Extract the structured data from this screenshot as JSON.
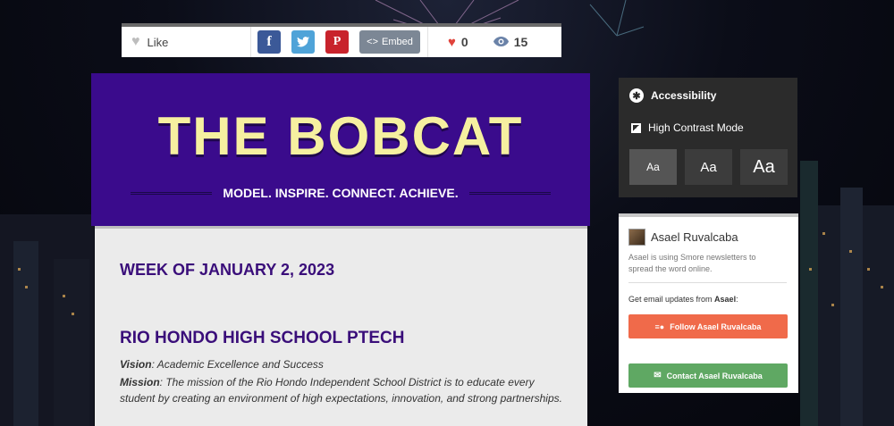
{
  "share_bar": {
    "like_label": "Like",
    "embed_label": "Embed",
    "likes_count": "0",
    "views_count": "15"
  },
  "header": {
    "title": "THE BOBCAT",
    "tagline": "MODEL. INSPIRE. CONNECT. ACHIEVE."
  },
  "content": {
    "week_heading": "WEEK OF JANUARY 2, 2023",
    "school_heading": "RIO HONDO HIGH SCHOOL PTECH",
    "vision_label": "Vision",
    "vision_text": ": Academic Excellence and Success",
    "mission_label": "Mission",
    "mission_text": ": The mission of the Rio Hondo Independent School District is to educate every student by creating an environment of high expectations, innovation, and strong partnerships."
  },
  "accessibility": {
    "title": "Accessibility",
    "high_contrast_label": "High Contrast Mode",
    "sizes": [
      "Aa",
      "Aa",
      "Aa"
    ]
  },
  "author": {
    "name": "Asael Ruvalcaba",
    "description": "Asael is using Smore newsletters to spread the word online.",
    "updates_prefix": "Get email updates from ",
    "updates_name": "Asael",
    "updates_suffix": ":",
    "follow_label": "Follow Asael Ruvalcaba",
    "contact_label": "Contact Asael Ruvalcaba"
  },
  "colors": {
    "header_bg": "#3a0b8c",
    "title_color": "#f6f0a0",
    "heading_color": "#3a0e7a",
    "follow_bg": "#f06a4a",
    "contact_bg": "#5fa863"
  }
}
